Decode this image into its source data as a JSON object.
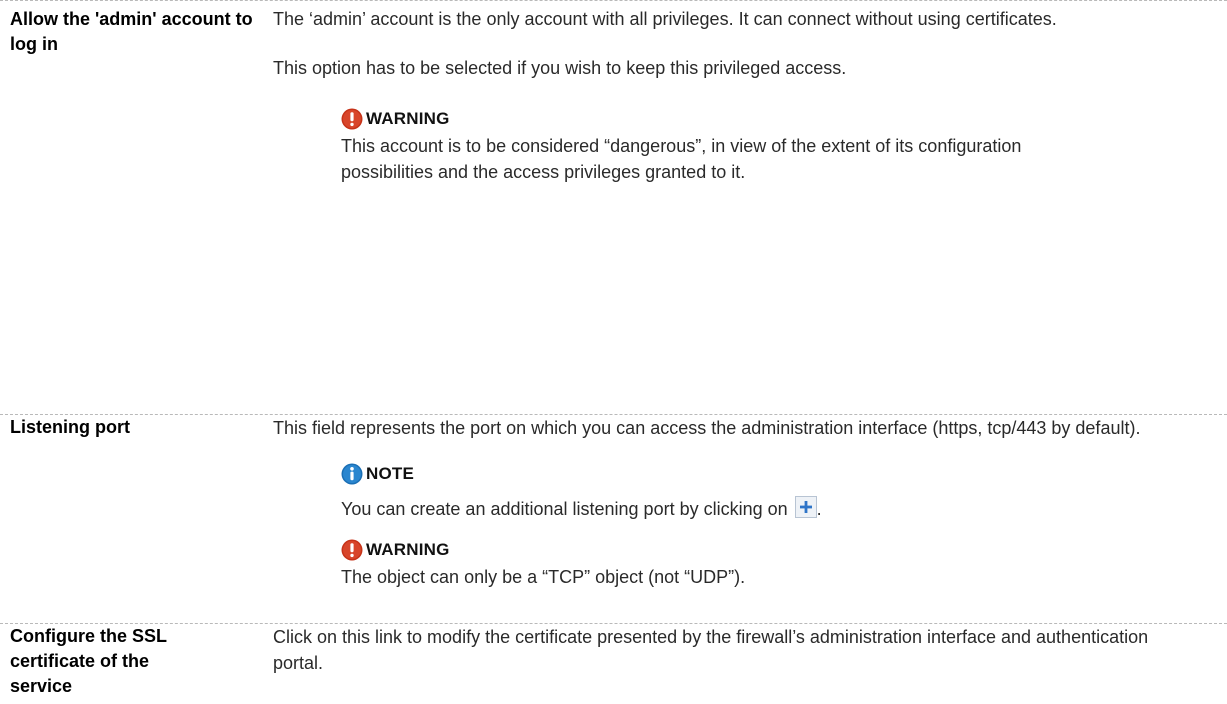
{
  "colors": {
    "warning_icon": "#c63218",
    "note_icon": "#1a6fb5",
    "divider": "#b9b9b9",
    "plus_button": "#2e74c8"
  },
  "rows": [
    {
      "term": "Allow the 'admin' account to log in",
      "desc_p1": "The ‘admin’ account is the only account with all privileges. It can connect without using certificates.",
      "desc_p2": "This option has to be selected if you wish to keep this privileged access.",
      "callout": {
        "icon": "warning-icon",
        "title": "WARNING",
        "text": "This account is to be considered “dangerous”, in view of the extent of its configuration possibilities and the access privileges granted to it."
      }
    },
    {
      "term": "Listening port",
      "desc_p1": "This field represents the port on which you can access the administration interface (https, tcp/443 by default).",
      "note": {
        "icon": "info-icon",
        "title": "NOTE",
        "text": "You can create an additional listening port by clicking on",
        "text_end": ".",
        "button_icon": "plus-icon"
      },
      "callout": {
        "icon": "warning-icon",
        "title": "WARNING",
        "text": "The object can only be a “TCP” object (not “UDP”)."
      }
    },
    {
      "term": "Configure the SSL certificate of the service",
      "desc_p1": "Click on this link to modify the certificate presented by the firewall’s administration interface and authentication portal."
    }
  ]
}
